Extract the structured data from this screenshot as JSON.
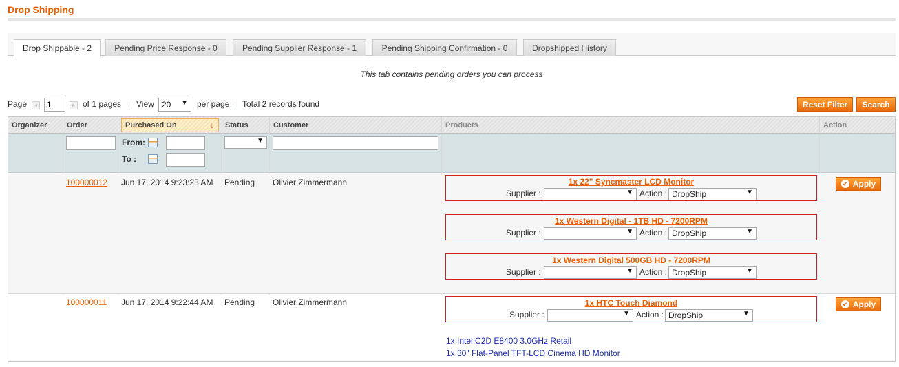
{
  "page": {
    "title": "Drop Shipping"
  },
  "tabs": [
    {
      "label": "Drop Shippable - 2",
      "active": true
    },
    {
      "label": "Pending Price Response - 0"
    },
    {
      "label": "Pending Supplier Response - 1"
    },
    {
      "label": "Pending Shipping Confirmation - 0"
    },
    {
      "label": "Dropshipped History"
    }
  ],
  "tab_note": "This tab contains pending orders you can process",
  "pager": {
    "page_label": "Page",
    "page_value": "1",
    "of_pages": "of 1 pages",
    "view_label": "View",
    "per_page_value": "20",
    "per_page_label": "per page",
    "separator": "|",
    "total": "Total 2 records found"
  },
  "actions": {
    "reset_filter": "Reset Filter",
    "search": "Search"
  },
  "columns": {
    "organizer": "Organizer",
    "order": "Order",
    "purchased_on": "Purchased On",
    "status": "Status",
    "customer": "Customer",
    "products": "Products",
    "action": "Action"
  },
  "filters": {
    "from_label": "From:",
    "to_label": "To :"
  },
  "product_labels": {
    "supplier": "Supplier :",
    "action": "Action :",
    "apply": "Apply"
  },
  "rows": [
    {
      "order": "100000012",
      "purchased_on": "Jun 17, 2014 9:23:23 AM",
      "status": "Pending",
      "customer": "Olivier Zimmermann",
      "products": [
        {
          "name": "1x 22\" Syncmaster LCD Monitor",
          "supplier": "",
          "action": "DropShip"
        },
        {
          "name": "1x Western Digital - 1TB HD - 7200RPM",
          "supplier": "",
          "action": "DropShip"
        },
        {
          "name": "1x Western Digital 500GB HD - 7200RPM",
          "supplier": "",
          "action": "DropShip"
        }
      ]
    },
    {
      "order": "100000011",
      "purchased_on": "Jun 17, 2014 9:22:44 AM",
      "status": "Pending",
      "customer": "Olivier Zimmermann",
      "products": [
        {
          "name": "1x HTC Touch Diamond",
          "supplier": "",
          "action": "DropShip"
        }
      ],
      "other_products": [
        "1x Intel C2D E8400 3.0GHz Retail",
        "1x 30\" Flat-Panel TFT-LCD Cinema HD Monitor"
      ]
    }
  ],
  "icons": {
    "dropdown": "▼",
    "sort": "↓",
    "apply": "✔",
    "prev": "◂",
    "next": "▸"
  },
  "colors": {
    "accent": "#eb5e00",
    "error_border": "#d21f1f",
    "filter_bg": "#d8e3e6",
    "product_link": "#1e2fb0"
  }
}
